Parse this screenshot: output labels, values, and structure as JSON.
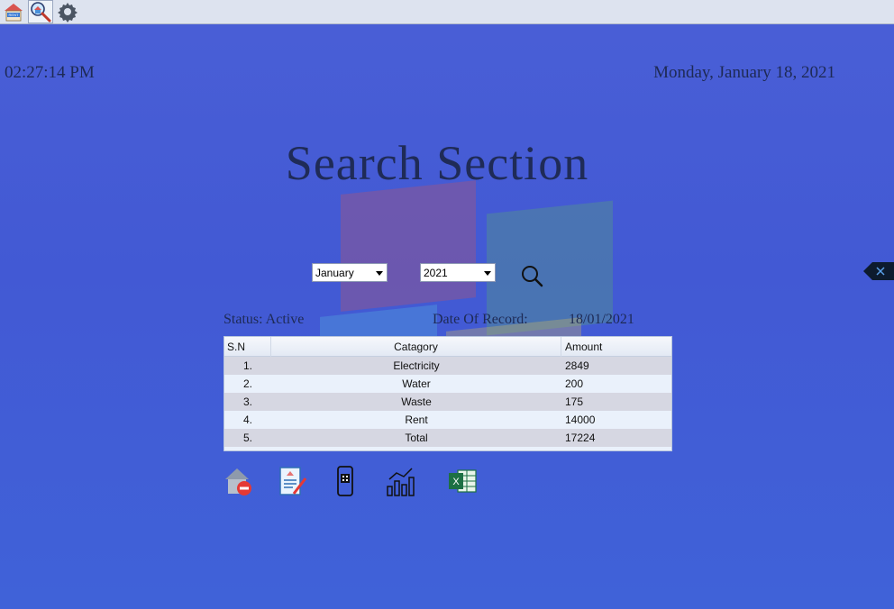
{
  "toolbar": {
    "icons": [
      "house-rent-icon",
      "search-house-icon",
      "gear-icon"
    ]
  },
  "header": {
    "time": "02:27:14 PM",
    "date": "Monday, January 18, 2021",
    "title": "Search Section"
  },
  "filters": {
    "month": "January",
    "year": "2021",
    "search_icon": "search-icon"
  },
  "record": {
    "status": "Status: Active",
    "date_label": "Date Of Record:",
    "date_value": "18/01/2021"
  },
  "table": {
    "headers": [
      "S.N",
      "Catagory",
      "Amount"
    ],
    "rows": [
      {
        "sn": "1.",
        "category": "Electricity",
        "amount": "2849"
      },
      {
        "sn": "2.",
        "category": "Water",
        "amount": "200"
      },
      {
        "sn": "3.",
        "category": "Waste",
        "amount": "175"
      },
      {
        "sn": "4.",
        "category": "Rent",
        "amount": "14000"
      },
      {
        "sn": "5.",
        "category": "Total",
        "amount": "17224"
      }
    ]
  },
  "actions": [
    "remove-house-icon",
    "edit-document-icon",
    "qr-phone-icon",
    "chart-icon",
    "excel-icon"
  ],
  "colors": {
    "background": "#4a5fd6",
    "text": "#1e2a55",
    "table_row_alt": "#d6d7e2",
    "table_row": "#eaf1fb"
  }
}
